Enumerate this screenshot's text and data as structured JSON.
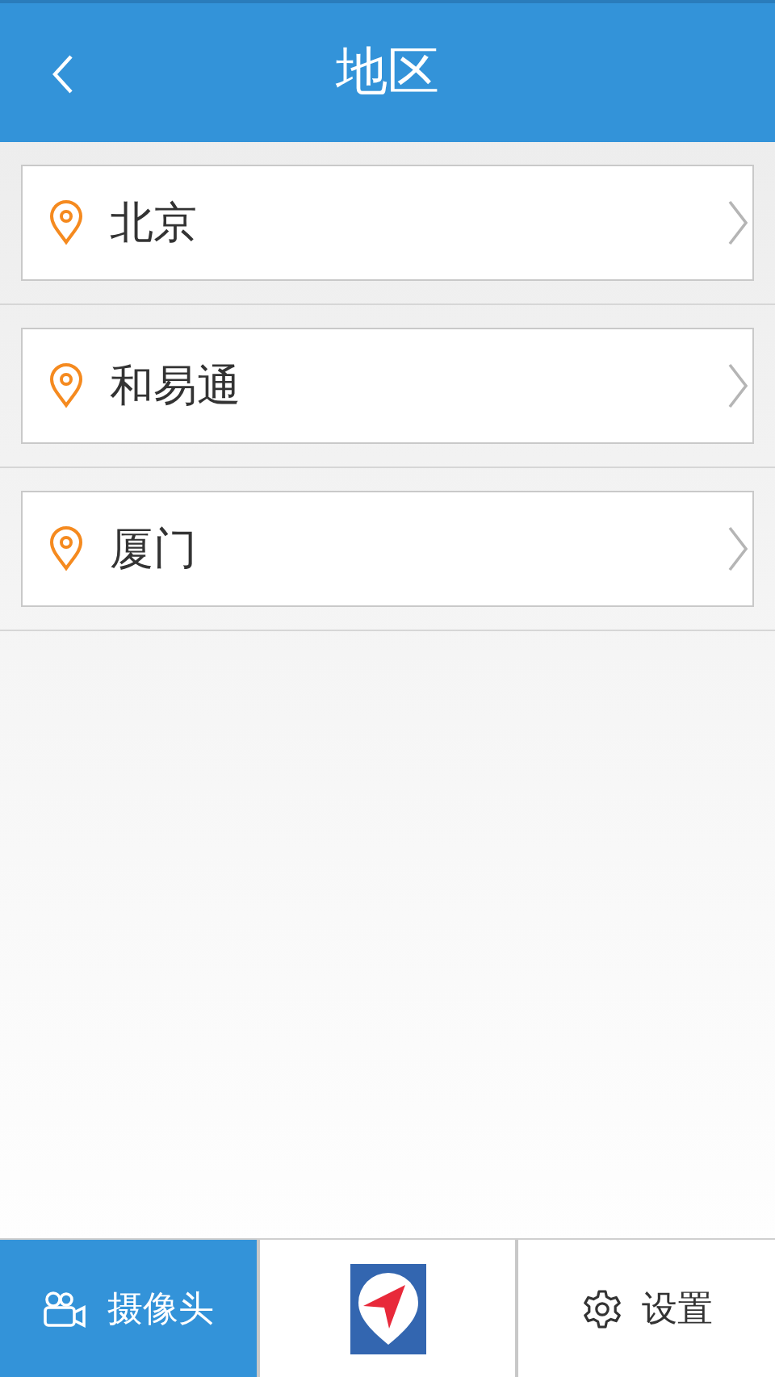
{
  "header": {
    "title": "地区"
  },
  "regions": [
    {
      "name": "北京"
    },
    {
      "name": "和易通"
    },
    {
      "name": "厦门"
    }
  ],
  "tabs": [
    {
      "kind": "camera",
      "label": "摄像头",
      "selected": true
    },
    {
      "kind": "navigate",
      "selected": false
    },
    {
      "kind": "settings",
      "label": "设置",
      "selected": false
    }
  ]
}
